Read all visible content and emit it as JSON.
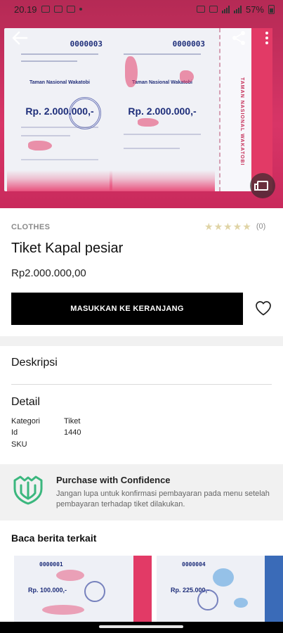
{
  "status_bar": {
    "time": "20.19",
    "battery": "57%"
  },
  "hero": {
    "ticket_serial_left": "0000003",
    "ticket_serial_right": "0000003",
    "ticket_title": "Taman Nasional Wakatobi",
    "ticket_amount_left": "Rp. 2.000.000,-",
    "ticket_amount_right": "Rp. 2.000.000,-",
    "ticket_side_text": "TAMAN NASIONAL WAKATOBI"
  },
  "product": {
    "category": "CLOTHES",
    "rating_count": "(0)",
    "title": "Tiket Kapal pesiar",
    "price": "Rp2.000.000,00",
    "add_to_cart_label": "MASUKKAN KE KERANJANG"
  },
  "description": {
    "title": "Deskripsi"
  },
  "detail": {
    "title": "Detail",
    "rows": [
      {
        "label": "Kategori",
        "value": "Tiket"
      },
      {
        "label": "Id",
        "value": "1440"
      },
      {
        "label": "SKU",
        "value": ""
      }
    ]
  },
  "confidence": {
    "title": "Purchase with Confidence",
    "text": "Jangan lupa untuk konfirmasi pembayaran pada menu setelah pembayaran terhadap tiket dilakukan.",
    "accent_color": "#3bb77e"
  },
  "related": {
    "title": "Baca berita terkait",
    "items": [
      {
        "serial": "0000001",
        "amount": "Rp. 100.000,-"
      },
      {
        "serial": "0000004",
        "amount": "Rp. 225.000,-"
      }
    ]
  }
}
